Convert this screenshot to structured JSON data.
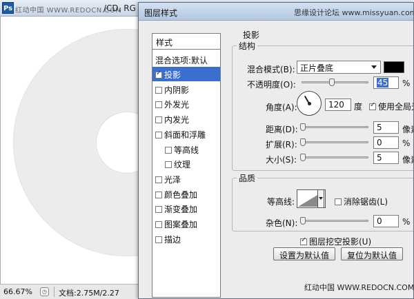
{
  "document": {
    "logo": "Ps",
    "watermark": "红动中国 WWW.REDOCN.COM",
    "title": "/CD, RG",
    "zoom": "66.67%",
    "status_icon": "◷",
    "doc_size": "文档:2.75M/2.27"
  },
  "dialog": {
    "title": "图层样式",
    "watermark": "思缘设计论坛 www.missyuan.com",
    "footer_watermark": "红动中国 WWW.REDOCN.COM"
  },
  "styles_panel": {
    "header": "样式",
    "blend_options": "混合选项:默认",
    "items": [
      {
        "label": "投影",
        "checked": true,
        "selected": true,
        "sub": false
      },
      {
        "label": "内阴影",
        "checked": false,
        "selected": false,
        "sub": false
      },
      {
        "label": "外发光",
        "checked": false,
        "selected": false,
        "sub": false
      },
      {
        "label": "内发光",
        "checked": false,
        "selected": false,
        "sub": false
      },
      {
        "label": "斜面和浮雕",
        "checked": false,
        "selected": false,
        "sub": false
      },
      {
        "label": "等高线",
        "checked": false,
        "selected": false,
        "sub": true
      },
      {
        "label": "纹理",
        "checked": false,
        "selected": false,
        "sub": true
      },
      {
        "label": "光泽",
        "checked": false,
        "selected": false,
        "sub": false
      },
      {
        "label": "颜色叠加",
        "checked": false,
        "selected": false,
        "sub": false
      },
      {
        "label": "渐变叠加",
        "checked": false,
        "selected": false,
        "sub": false
      },
      {
        "label": "图案叠加",
        "checked": false,
        "selected": false,
        "sub": false
      },
      {
        "label": "描边",
        "checked": false,
        "selected": false,
        "sub": false
      }
    ]
  },
  "drop_shadow": {
    "section_title": "投影",
    "structure": {
      "title": "结构",
      "blend_mode_label": "混合模式(B):",
      "blend_mode_value": "正片叠底",
      "shadow_color": "#000000",
      "opacity_label": "不透明度(O):",
      "opacity_value": "45",
      "opacity_unit": "%",
      "opacity_level": 0.45,
      "angle_label": "角度(A):",
      "angle_value": "120",
      "angle_unit": "度",
      "global_light_label": "使用全局光",
      "global_light_checked": true,
      "distance_label": "距离(D):",
      "distance_value": "5",
      "distance_unit": "像素",
      "spread_label": "扩展(R):",
      "spread_value": "0",
      "spread_unit": "%",
      "size_label": "大小(S):",
      "size_value": "5",
      "size_unit": "像素"
    },
    "quality": {
      "title": "品质",
      "contour_label": "等高线:",
      "anti_alias_label": "消除锯齿(L)",
      "anti_alias_checked": false,
      "noise_label": "杂色(N):",
      "noise_value": "0",
      "noise_unit": "%"
    },
    "knockout_label": "图层挖空投影(U)",
    "knockout_checked": true,
    "make_default_button": "设置为默认值",
    "reset_default_button": "复位为默认值"
  }
}
